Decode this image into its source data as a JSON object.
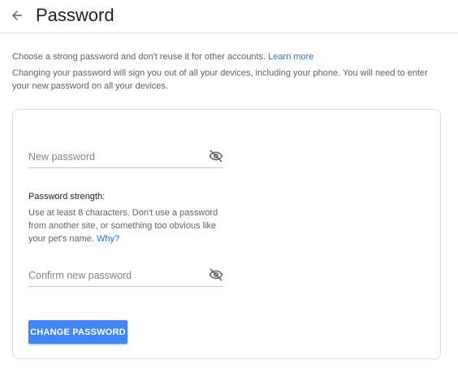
{
  "header": {
    "title": "Password",
    "back_icon": "arrow-left-icon"
  },
  "intro": {
    "line1_text": "Choose a strong password and don't reuse it for other accounts. ",
    "learn_more_link": "Learn more",
    "line2_text": "Changing your password will sign you out of all your devices, including your phone. You will need to enter your new password on all your devices."
  },
  "form": {
    "new_password": {
      "placeholder": "New password",
      "value": "",
      "visibility_icon": "eye-off-icon"
    },
    "strength": {
      "label": "Password strength:",
      "help_text": "Use at least 8 characters. Don't use a password from another site, or something too obvious like your pet's name. ",
      "why_link": "Why?"
    },
    "confirm_password": {
      "placeholder": "Confirm new password",
      "value": "",
      "visibility_icon": "eye-off-icon"
    },
    "submit_label": "CHANGE PASSWORD"
  },
  "colors": {
    "accent": "#1a73e8",
    "button": "#4285f4",
    "text_secondary": "#5f6368",
    "border": "#dadce0"
  }
}
